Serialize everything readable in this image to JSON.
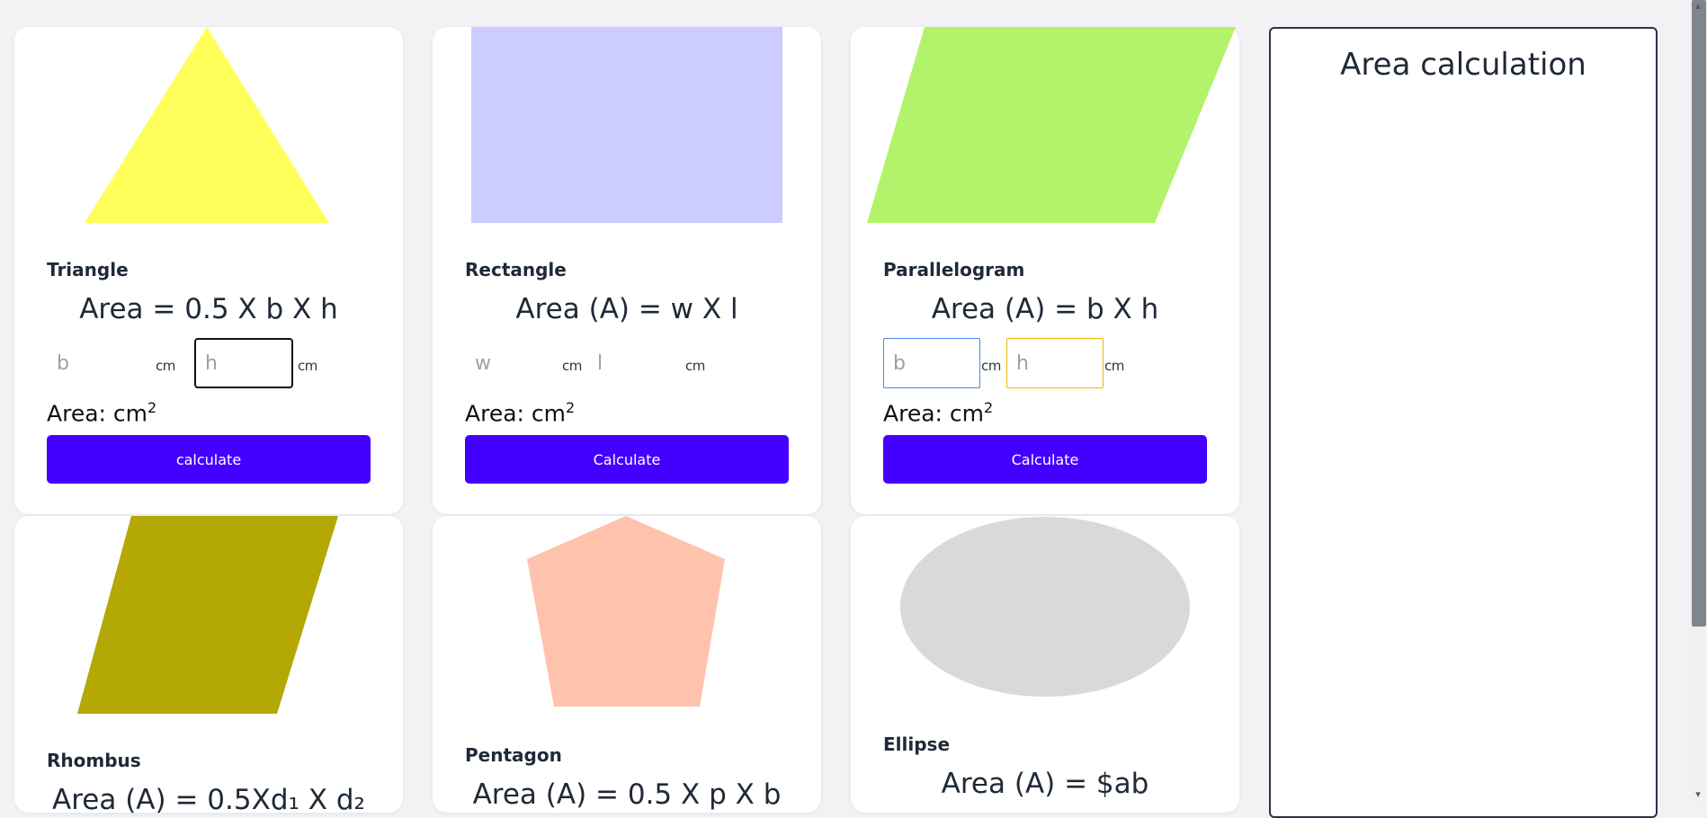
{
  "cards": {
    "triangle": {
      "name": "Triangle",
      "formula": "Area = 0.5 X b X h",
      "input1_placeholder": "b",
      "input2_placeholder": "h",
      "unit": "cm",
      "result_label": "Area: cm",
      "result_exponent": "2",
      "button_label": "calculate",
      "color": "#ffff5c"
    },
    "rectangle": {
      "name": "Rectangle",
      "formula": "Area (A) = w X l",
      "input1_placeholder": "w",
      "input2_placeholder": "l",
      "unit": "cm",
      "result_label": "Area: cm",
      "result_exponent": "2",
      "button_label": "Calculate",
      "color": "#ccccff"
    },
    "parallelogram": {
      "name": "Parallelogram",
      "formula": "Area (A) = b X h",
      "input1_placeholder": "b",
      "input2_placeholder": "h",
      "unit": "cm",
      "result_label": "Area: cm",
      "result_exponent": "2",
      "button_label": "Calculate",
      "color": "#b3f26b"
    },
    "rhombus": {
      "name": "Rhombus",
      "formula": "Area (A) = 0.5Xd₁ X d₂",
      "color": "#b3a804"
    },
    "pentagon": {
      "name": "Pentagon",
      "formula": "Area (A) = 0.5 X p X b",
      "color": "#ffc2ad"
    },
    "ellipse": {
      "name": "Ellipse",
      "formula": "Area (A) = $ab",
      "color": "#d9d9d9"
    }
  },
  "panel": {
    "title": "Area calculation"
  },
  "colors": {
    "button": "#4400ff",
    "panel_border": "#273449"
  }
}
